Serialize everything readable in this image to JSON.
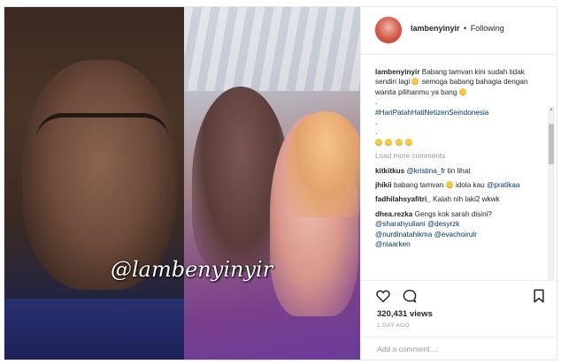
{
  "header": {
    "username": "lambenyinyir",
    "separator": "•",
    "follow_status": "Following"
  },
  "media": {
    "watermark": "@lambenyinyir"
  },
  "caption": {
    "username": "lambenyinyir",
    "text1": "Babang tamvan kini sudah tidak sendiri lagi",
    "text2": "semoga babang bahagia dengan wanita pilihanmu ya bang",
    "line_dot1": ".",
    "hashtag": "#HariPatahHatiNetizenSeindonesia",
    "line_dot2": ".",
    "line_dot3": "."
  },
  "load_more": "Load more comments",
  "comments": [
    {
      "user": "kitkitkus",
      "mention": "@kristina_fr",
      "text": "tin lihat"
    },
    {
      "user": "jhikii",
      "text_before": "babang tamvan",
      "text_after": "idola kau",
      "mention": "@pratikaa"
    },
    {
      "user": "fadhilahsyafitri_",
      "text": "Kalah nih laki2 wkwk"
    },
    {
      "user": "dhea.rezka",
      "text": "Gengs kok sarah disini?",
      "mentions": [
        "@sharahyuliani",
        "@desyrzk",
        "@nurdinatahikma",
        "@evachoirulr",
        "@niaarken"
      ]
    }
  ],
  "icons": {
    "heart": "heart-icon",
    "comment": "comment-icon",
    "bookmark": "bookmark-icon"
  },
  "stats": {
    "views": "320,431 views",
    "time": "1 DAY AGO"
  },
  "add_comment": {
    "placeholder": "Add a comment…"
  },
  "colors": {
    "link": "#003569",
    "muted": "#999999",
    "text": "#262626"
  }
}
